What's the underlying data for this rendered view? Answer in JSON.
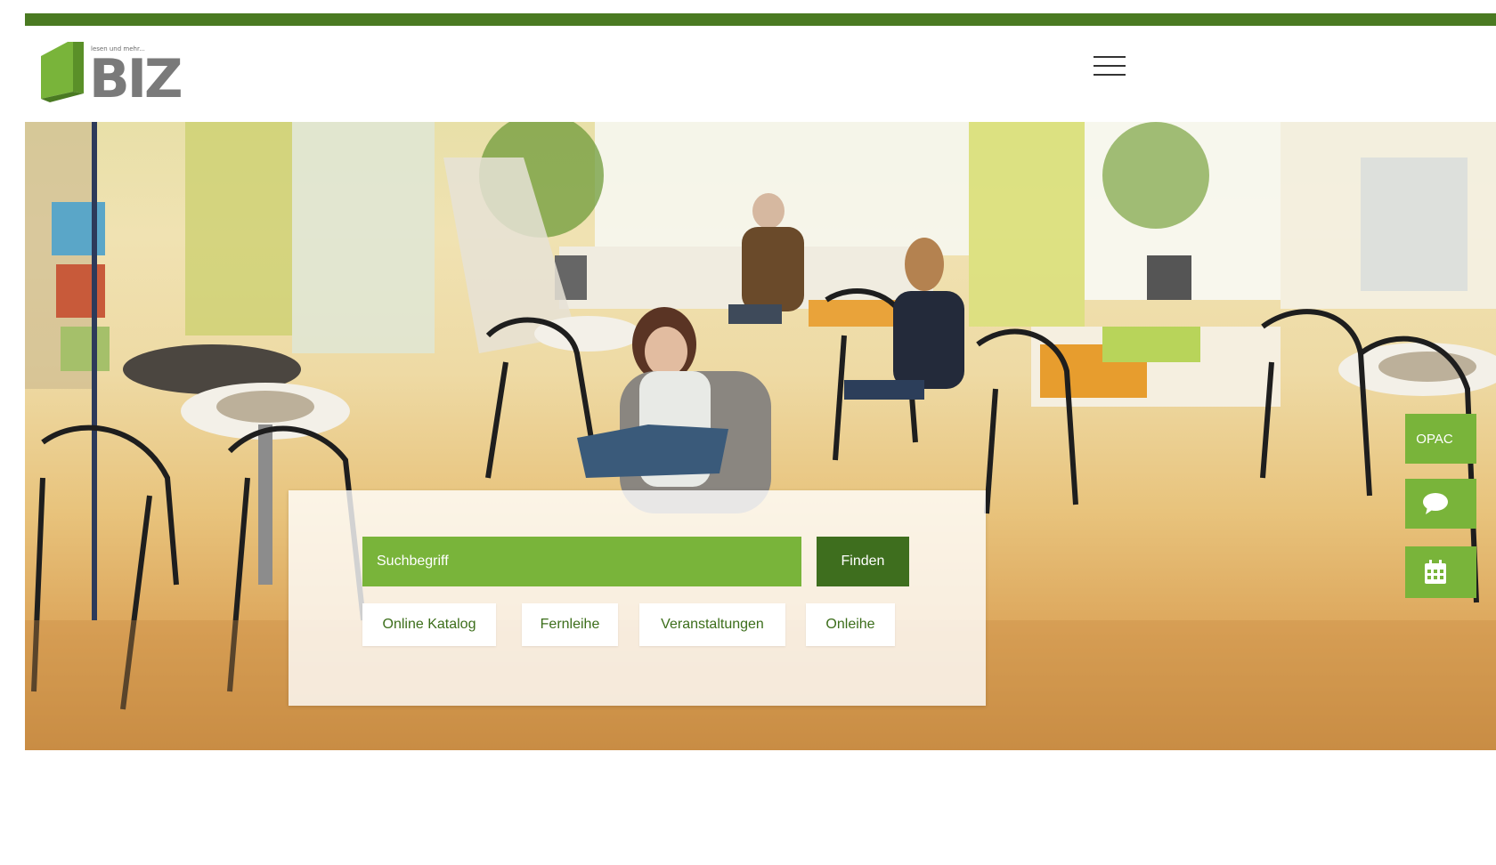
{
  "header": {
    "logo_tagline": "lesen und mehr...",
    "logo_text": "BIZ",
    "menu_icon": "hamburger-icon"
  },
  "search": {
    "placeholder": "Suchbegriff",
    "submit_label": "Finden",
    "quick_links": [
      "Online Katalog",
      "Fernleihe",
      "Veranstaltungen",
      "Onleihe"
    ]
  },
  "side_tabs": {
    "opac_label": "OPAC",
    "chat_icon": "chat-bubble-icon",
    "calendar_icon": "calendar-icon"
  },
  "colors": {
    "brand_dark_green": "#4a7a22",
    "brand_green": "#79b43a",
    "button_dark_green": "#3e6e1e",
    "logo_gray": "#7a7a7a"
  }
}
